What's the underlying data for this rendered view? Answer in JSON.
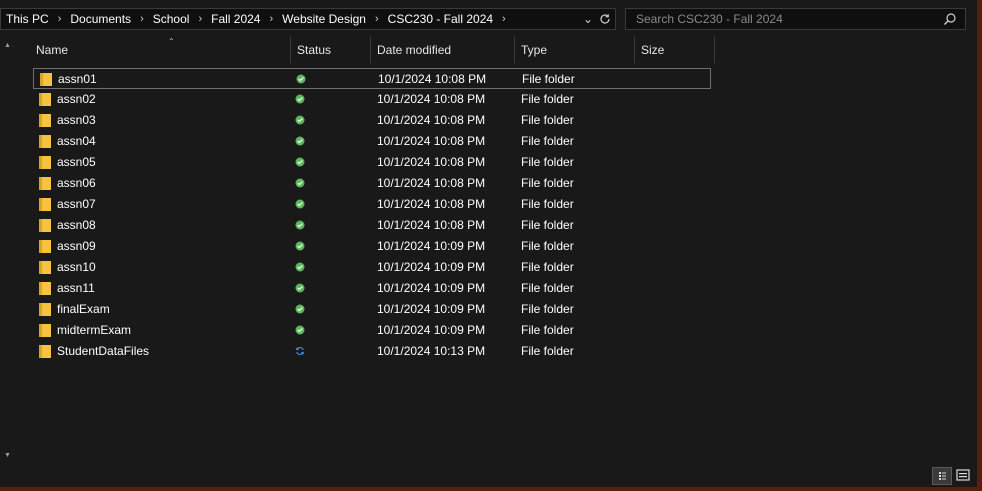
{
  "breadcrumb": [
    "This PC",
    "Documents",
    "School",
    "Fall 2024",
    "Website Design",
    "CSC230 - Fall 2024"
  ],
  "search": {
    "placeholder": "Search CSC230 - Fall 2024"
  },
  "columns": [
    "Name",
    "Status",
    "Date modified",
    "Type",
    "Size"
  ],
  "files": [
    {
      "name": "assn01",
      "status": "synced",
      "date": "10/1/2024 10:08 PM",
      "type": "File folder"
    },
    {
      "name": "assn02",
      "status": "synced",
      "date": "10/1/2024 10:08 PM",
      "type": "File folder"
    },
    {
      "name": "assn03",
      "status": "synced",
      "date": "10/1/2024 10:08 PM",
      "type": "File folder"
    },
    {
      "name": "assn04",
      "status": "synced",
      "date": "10/1/2024 10:08 PM",
      "type": "File folder"
    },
    {
      "name": "assn05",
      "status": "synced",
      "date": "10/1/2024 10:08 PM",
      "type": "File folder"
    },
    {
      "name": "assn06",
      "status": "synced",
      "date": "10/1/2024 10:08 PM",
      "type": "File folder"
    },
    {
      "name": "assn07",
      "status": "synced",
      "date": "10/1/2024 10:08 PM",
      "type": "File folder"
    },
    {
      "name": "assn08",
      "status": "synced",
      "date": "10/1/2024 10:08 PM",
      "type": "File folder"
    },
    {
      "name": "assn09",
      "status": "synced",
      "date": "10/1/2024 10:09 PM",
      "type": "File folder"
    },
    {
      "name": "assn10",
      "status": "synced",
      "date": "10/1/2024 10:09 PM",
      "type": "File folder"
    },
    {
      "name": "assn11",
      "status": "synced",
      "date": "10/1/2024 10:09 PM",
      "type": "File folder"
    },
    {
      "name": "finalExam",
      "status": "synced",
      "date": "10/1/2024 10:09 PM",
      "type": "File folder"
    },
    {
      "name": "midtermExam",
      "status": "synced",
      "date": "10/1/2024 10:09 PM",
      "type": "File folder"
    },
    {
      "name": "StudentDataFiles",
      "status": "syncing",
      "date": "10/1/2024 10:13 PM",
      "type": "File folder"
    }
  ],
  "colors": {
    "folder": "#f5c242",
    "synced": "#5cb85c",
    "syncing": "#3a8ee6",
    "background": "#191919"
  },
  "icons": {
    "dropdown": "chevron-down-icon",
    "refresh": "refresh-icon",
    "search": "search-icon",
    "details_view": "details-view-icon",
    "tiles_view": "large-icons-view-icon"
  }
}
